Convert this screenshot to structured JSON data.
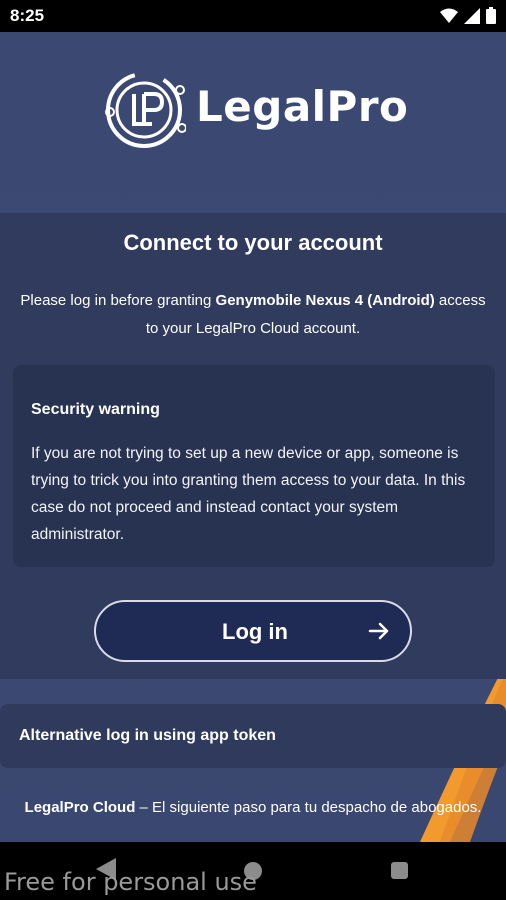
{
  "status_bar": {
    "time": "8:25"
  },
  "brand": {
    "name": "LegalPro"
  },
  "connect": {
    "title": "Connect to your account",
    "desc_prefix": "Please log in before granting ",
    "device_name": "Genymobile Nexus 4 (Android)",
    "desc_suffix": " access to your LegalPro Cloud account."
  },
  "warning": {
    "title": "Security warning",
    "text": "If you are not trying to set up a new device or app, someone is trying to trick you into granting them access to your data. In this case do not proceed and instead contact your system administrator."
  },
  "login_button": {
    "label": "Log in"
  },
  "alternative": {
    "label": "Alternative log in using app token"
  },
  "footer": {
    "brand": "LegalPro Cloud",
    "tagline": " – El siguiente paso para tu despacho de abogados."
  },
  "watermark": "Free for personal use",
  "colors": {
    "background": "#3a4670",
    "accent_orange": "#f29a2e",
    "button_fill": "#1f2b55"
  }
}
